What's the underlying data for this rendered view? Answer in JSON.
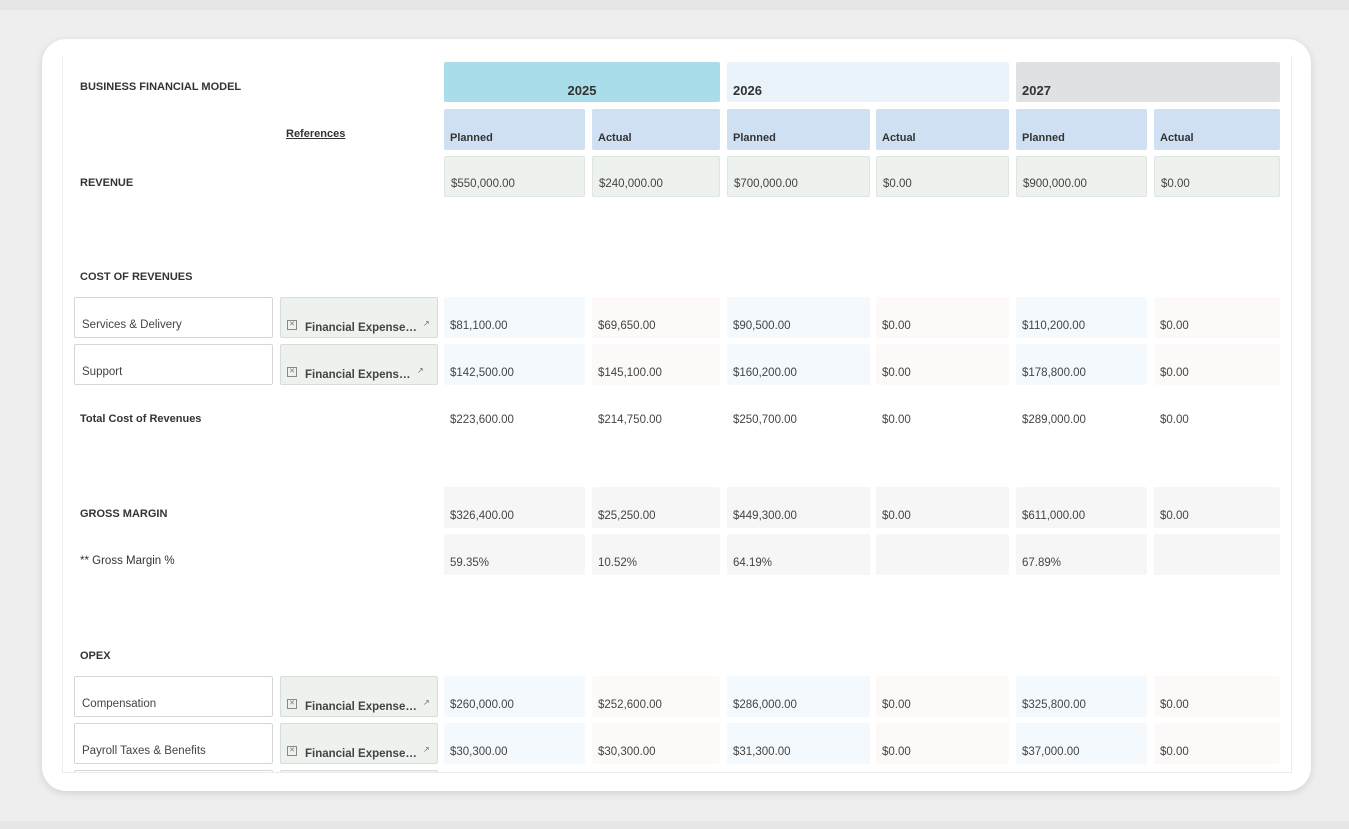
{
  "title": "BUSINESS FINANCIAL MODEL",
  "references_label": "References",
  "years": [
    "2025",
    "2026",
    "2027"
  ],
  "sub_headers": [
    "Planned",
    "Actual",
    "Planned",
    "Actual",
    "Planned",
    "Actual"
  ],
  "colors": {
    "year_2025": "#a8dde9",
    "year_2026": "#eaf2fa",
    "year_2027": "#dfe1e2",
    "sub_header": "#cfe0f3"
  },
  "revenue": {
    "label": "REVENUE",
    "values": [
      "$550,000.00",
      "$240,000.00",
      "$700,000.00",
      "$0.00",
      "$900,000.00",
      "$0.00"
    ]
  },
  "cost_of_revenues": {
    "label": "COST OF REVENUES",
    "rows": [
      {
        "name": "Services & Delivery",
        "ref": "Financial Expense Details",
        "values": [
          "$81,100.00",
          "$69,650.00",
          "$90,500.00",
          "$0.00",
          "$110,200.00",
          "$0.00"
        ]
      },
      {
        "name": "Support",
        "ref": "Financial Expense Details",
        "values": [
          "$142,500.00",
          "$145,100.00",
          "$160,200.00",
          "$0.00",
          "$178,800.00",
          "$0.00"
        ]
      }
    ],
    "total": {
      "label": "Total Cost of Revenues",
      "values": [
        "$223,600.00",
        "$214,750.00",
        "$250,700.00",
        "$0.00",
        "$289,000.00",
        "$0.00"
      ]
    }
  },
  "gross_margin": {
    "label": "GROSS MARGIN",
    "values": [
      "$326,400.00",
      "$25,250.00",
      "$449,300.00",
      "$0.00",
      "$611,000.00",
      "$0.00"
    ]
  },
  "gross_margin_pct": {
    "label": "** Gross Margin %",
    "values": [
      "59.35%",
      "10.52%",
      "64.19%",
      "",
      "67.89%",
      ""
    ]
  },
  "opex": {
    "label": "OPEX",
    "rows": [
      {
        "name": "Compensation",
        "ref": "Financial Expense Details",
        "values": [
          "$260,000.00",
          "$252,600.00",
          "$286,000.00",
          "$0.00",
          "$325,800.00",
          "$0.00"
        ]
      },
      {
        "name": "Payroll Taxes & Benefits",
        "ref": "Financial Expense Details",
        "values": [
          "$30,300.00",
          "$30,300.00",
          "$31,300.00",
          "$0.00",
          "$37,000.00",
          "$0.00"
        ]
      }
    ]
  }
}
